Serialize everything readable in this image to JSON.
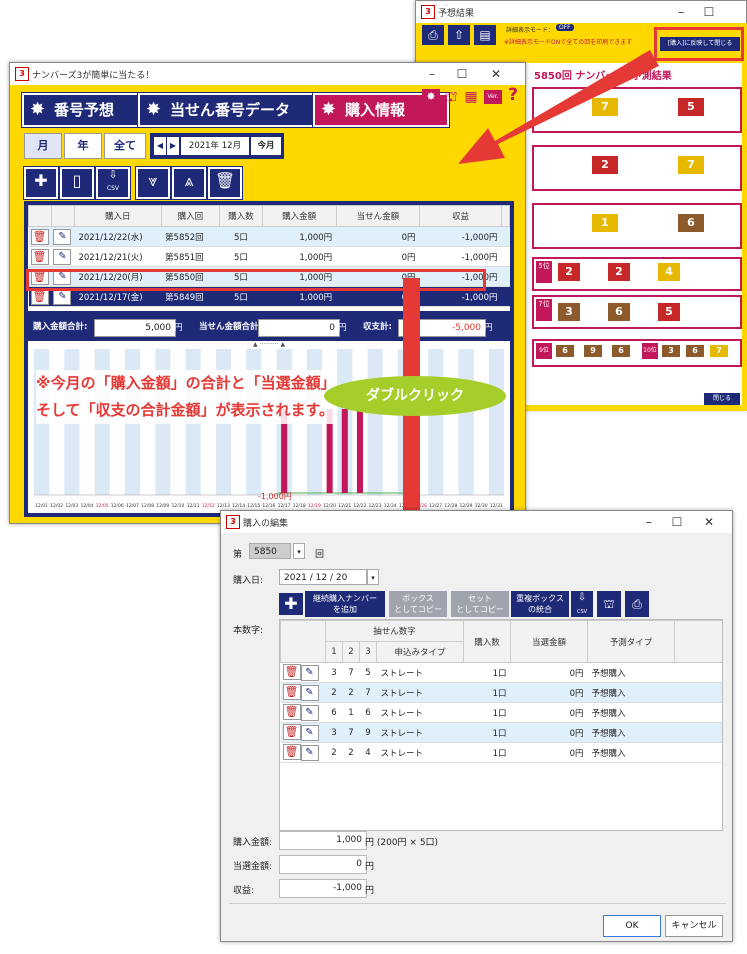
{
  "window_back": {
    "title": "予想結果",
    "detail_mode_label": "詳細表示モード：",
    "detail_mode_value": "OFF",
    "hint": "※詳細表示モードONで全ての回を印刷できます",
    "apply_button": "[購入]に反映して閉じる",
    "result_title": "5850回 ナンバーズ3予測結果",
    "close_button": "閉じる",
    "balls_big": [
      "7",
      "5",
      "2",
      "7",
      "1",
      "6"
    ],
    "rank_rows": [
      {
        "rank": "5位",
        "balls": [
          "9",
          "2",
          "2",
          "4"
        ]
      },
      {
        "rank": "7位",
        "balls": [
          "9",
          "3",
          "6",
          "5"
        ]
      },
      {
        "rank": "9位",
        "balls": [
          "6",
          "9",
          "6"
        ]
      },
      {
        "rank": "10位",
        "balls": [
          "3",
          "6",
          "7"
        ]
      }
    ]
  },
  "window_main": {
    "title": "ナンバーズ3が簡単に当たる！",
    "nav": [
      "番号予想",
      "当せん番号データ",
      "購入情報"
    ],
    "ver": "Ver.",
    "help": "?",
    "period_tabs": [
      "月",
      "年",
      "全て"
    ],
    "month": "2021年 12月",
    "this_month": "今月",
    "csv": "CSV",
    "columns": [
      "購入日",
      "購入回",
      "購入数",
      "購入金額",
      "当せん金額",
      "収益"
    ],
    "rows": [
      {
        "date": "2021/12/22(水)",
        "round": "第5852回",
        "count": "5口",
        "amount": "1,000円",
        "win": "0円",
        "profit": "-1,000円"
      },
      {
        "date": "2021/12/21(火)",
        "round": "第5851回",
        "count": "5口",
        "amount": "1,000円",
        "win": "0円",
        "profit": "-1,000円"
      },
      {
        "date": "2021/12/20(月)",
        "round": "第5850回",
        "count": "5口",
        "amount": "1,000円",
        "win": "0円",
        "profit": "-1,000円"
      },
      {
        "date": "2021/12/17(金)",
        "round": "第5849回",
        "count": "5口",
        "amount": "1,000円",
        "win": "0円",
        "profit": "-1,000円"
      }
    ],
    "sum_purchase_label": "購入金額合計:",
    "sum_purchase_value": "5,000",
    "sum_win_label": "当せん金額合計",
    "sum_win_value": "0",
    "sum_profit_label": "収支計:",
    "sum_profit_value": "-5,000",
    "yen": "円",
    "chart_min_label": "-1,000円",
    "annotation": "※今月の「購入金額」の合計と「当選金額」そして「収支の合計金額」が表示されます。",
    "dates": [
      "12/01",
      "12/02",
      "12/03",
      "12/04",
      "12/05",
      "12/06",
      "12/07",
      "12/08",
      "12/09",
      "12/10",
      "12/11",
      "12/12",
      "12/13",
      "12/14",
      "12/15",
      "12/16",
      "12/17",
      "12/18",
      "12/19",
      "12/20",
      "12/21",
      "12/22",
      "12/23",
      "12/24",
      "12/25",
      "12/26",
      "12/27",
      "12/28",
      "12/29",
      "12/30",
      "12/31"
    ]
  },
  "callout": "ダブルクリック",
  "dialog": {
    "title": "購入の編集",
    "round_prefix": "第",
    "round_value": "5850",
    "round_suffix": "回",
    "date_label": "購入日:",
    "date_value": "2021 / 12 / 20",
    "btn_add_cont": "継続購入ナンバー\nを追加",
    "btn_box_copy": "ボックス\nとしてコピー",
    "btn_set_copy": "セット\nとしてコピー",
    "btn_dup_merge": "重複ボックス\nの統合",
    "numbers_label": "本数字:",
    "group_header": "抽せん数字",
    "columns": [
      "1",
      "2",
      "3",
      "申込みタイプ",
      "購入数",
      "当選金額",
      "予測タイプ"
    ],
    "rows": [
      {
        "d1": "3",
        "d2": "7",
        "d3": "5",
        "type": "ストレート",
        "qty": "1口",
        "win": "0円",
        "pred": "予想購入"
      },
      {
        "d1": "2",
        "d2": "2",
        "d3": "7",
        "type": "ストレート",
        "qty": "1口",
        "win": "0円",
        "pred": "予想購入"
      },
      {
        "d1": "6",
        "d2": "1",
        "d3": "6",
        "type": "ストレート",
        "qty": "1口",
        "win": "0円",
        "pred": "予想購入"
      },
      {
        "d1": "3",
        "d2": "7",
        "d3": "9",
        "type": "ストレート",
        "qty": "1口",
        "win": "0円",
        "pred": "予想購入"
      },
      {
        "d1": "2",
        "d2": "2",
        "d3": "4",
        "type": "ストレート",
        "qty": "1口",
        "win": "0円",
        "pred": "予想購入"
      }
    ],
    "purchase_label": "購入金額:",
    "purchase_value": "1,000",
    "purchase_unit": "円 (200円 × 5口)",
    "win_label": "当選金額:",
    "win_value": "0",
    "win_unit": "円",
    "profit_label": "収益:",
    "profit_value": "-1,000",
    "profit_unit": "円",
    "ok": "OK",
    "cancel": "キャンセル"
  }
}
